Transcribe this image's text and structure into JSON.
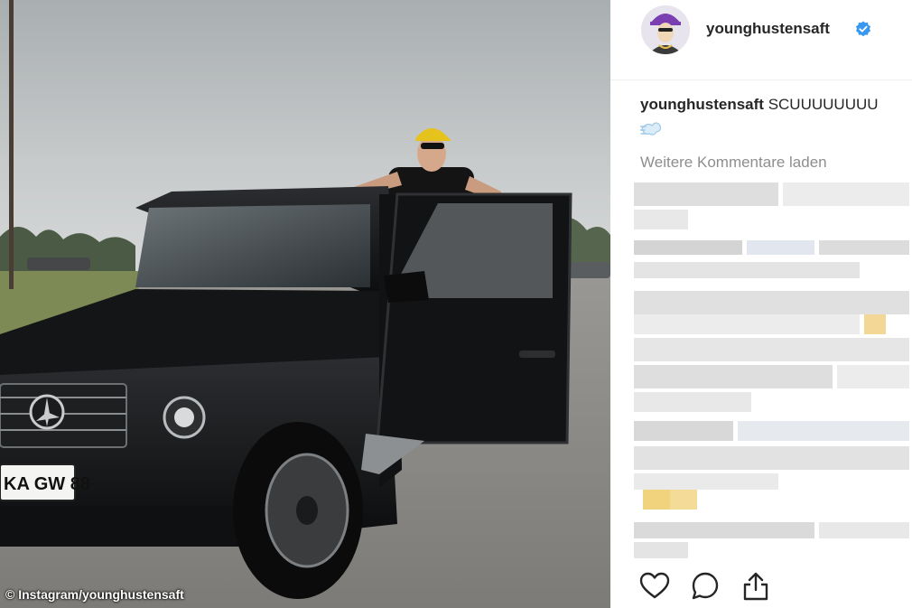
{
  "photo": {
    "credit": "© Instagram/younghustensaft",
    "license_plate": "KA GW 88"
  },
  "post": {
    "username": "younghustensaft",
    "verified": true,
    "caption_user": "younghustensaft",
    "caption_text": "SCUUUUUUUU",
    "caption_emoji": "wind-emoji",
    "load_more_label": "Weitere Kommentare laden"
  },
  "actions": [
    "heart-icon",
    "comment-icon",
    "share-icon"
  ],
  "colors": {
    "verified_blue": "#3897f0",
    "text_primary": "#262626",
    "text_secondary": "#8e8e8e"
  }
}
